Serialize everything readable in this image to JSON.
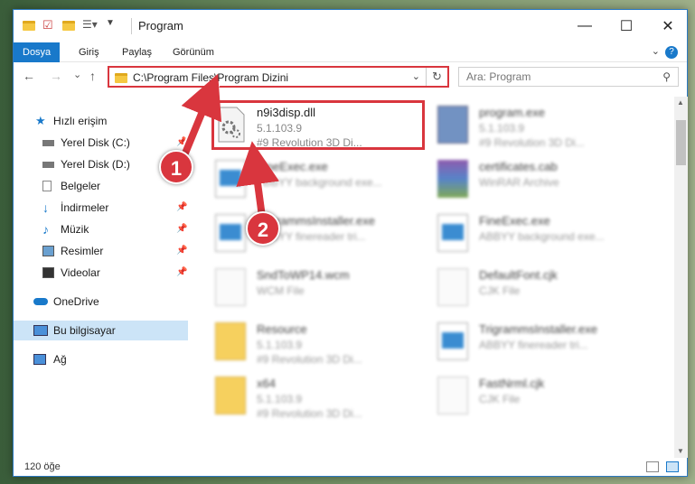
{
  "window": {
    "title": "Program",
    "controls": {
      "minimize": "—",
      "maximize": "☐",
      "close": "✕"
    }
  },
  "ribbon": {
    "tabs": [
      "Dosya",
      "Giriş",
      "Paylaş",
      "Görünüm"
    ],
    "active_tab": "Dosya"
  },
  "nav": {
    "back": "←",
    "forward": "→",
    "recent": "⌄",
    "up": "↑",
    "address": "C:\\Program Files\\Program Dizini",
    "refresh": "↻",
    "search_placeholder": "Ara: Program"
  },
  "sidebar": {
    "items": [
      {
        "label": "Hızlı erişim",
        "icon": "star-icon",
        "pinned": false
      },
      {
        "label": "Yerel Disk (C:)",
        "icon": "drive-icon",
        "pinned": true
      },
      {
        "label": "Yerel Disk (D:)",
        "icon": "drive-icon",
        "pinned": false
      },
      {
        "label": "Belgeler",
        "icon": "documents-icon",
        "pinned": false
      },
      {
        "label": "İndirmeler",
        "icon": "download-icon",
        "pinned": true
      },
      {
        "label": "Müzik",
        "icon": "music-icon",
        "pinned": true
      },
      {
        "label": "Resimler",
        "icon": "pictures-icon",
        "pinned": true
      },
      {
        "label": "Videolar",
        "icon": "videos-icon",
        "pinned": true
      },
      {
        "label": "OneDrive",
        "icon": "cloud-icon",
        "pinned": false
      },
      {
        "label": "Bu bilgisayar",
        "icon": "computer-icon",
        "pinned": false
      },
      {
        "label": "Ağ",
        "icon": "network-icon",
        "pinned": false
      }
    ],
    "pin_glyph": "📌"
  },
  "files": [
    {
      "name": "n9i3disp.dll",
      "line1": "5.1.103.9",
      "line2": "#9 Revolution 3D Di...",
      "icon": "dll-gear-icon"
    },
    {
      "name": "program.exe",
      "line1": "5.1.103.9",
      "line2": "#9 Revolution 3D Di...",
      "icon": "exe-icon"
    },
    {
      "name": "FineExec.exe",
      "line1": "ABBYY background exe...",
      "line2": "",
      "icon": "exe-window-icon"
    },
    {
      "name": "certificates.cab",
      "line1": "WinRAR Archive",
      "line2": "",
      "icon": "archive-icon"
    },
    {
      "name": "TrigrammsInstaller.exe",
      "line1": "ABBYY finereader tri...",
      "line2": "",
      "icon": "exe-window-icon"
    },
    {
      "name": "FineExec.exe",
      "line1": "ABBYY background exe...",
      "line2": "",
      "icon": "exe-window-icon"
    },
    {
      "name": "SndToWP14.wcm",
      "line1": "WCM File",
      "line2": "",
      "icon": "blank-file-icon"
    },
    {
      "name": "DefaultFont.cjk",
      "line1": "CJK File",
      "line2": "",
      "icon": "blank-file-icon"
    },
    {
      "name": "Resource",
      "line1": "5.1.103.9",
      "line2": "#9 Revolution 3D Di...",
      "icon": "folder-doc-icon"
    },
    {
      "name": "TrigrammsInstaller.exe",
      "line1": "ABBYY finereader tri...",
      "line2": "",
      "icon": "exe-window-icon"
    },
    {
      "name": "x64",
      "line1": "5.1.103.9",
      "line2": "#9 Revolution 3D Di...",
      "icon": "folder-doc-icon"
    },
    {
      "name": "FastNrml.cjk",
      "line1": "CJK File",
      "line2": "",
      "icon": "blank-file-icon"
    }
  ],
  "status": {
    "count": "120 öğe"
  },
  "annotations": {
    "badge1": "1",
    "badge2": "2",
    "accent": "#d9363e"
  }
}
